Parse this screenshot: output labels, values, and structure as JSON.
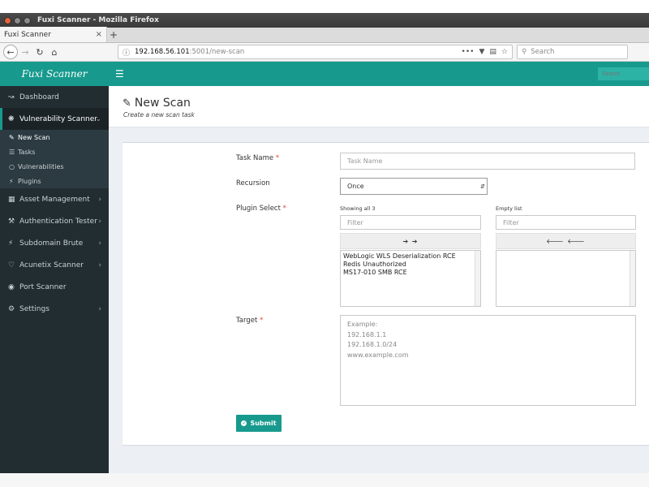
{
  "window": {
    "title": "Fuxi Scanner - Mozilla Firefox",
    "tab_title": "Fuxi Scanner",
    "tab_close": "×",
    "new_tab": "+"
  },
  "browser": {
    "url_host": "192.168.56.101",
    "url_path": ":5001/new-scan",
    "search_placeholder": "Search",
    "page_actions": "•••"
  },
  "app": {
    "brand": "Fuxi Scanner",
    "nav_search_placeholder": "Search",
    "accent_color": "#179a8d",
    "sidebar_color": "#222d32"
  },
  "sidebar": {
    "items": [
      {
        "label": "Dashboard",
        "icon": "line-chart-icon"
      },
      {
        "label": "Vulnerability Scanner",
        "icon": "bug-icon"
      },
      {
        "label": "Asset Management",
        "icon": "calendar-icon"
      },
      {
        "label": "Authentication Tester",
        "icon": "gavel-icon"
      },
      {
        "label": "Subdomain Brute",
        "icon": "bolt-icon"
      },
      {
        "label": "Acunetix Scanner",
        "icon": "heartbeat-icon"
      },
      {
        "label": "Port Scanner",
        "icon": "dot-circle-icon"
      },
      {
        "label": "Settings",
        "icon": "cogs-icon"
      }
    ],
    "sub_items": [
      {
        "label": "New Scan",
        "icon": "edit-icon"
      },
      {
        "label": "Tasks",
        "icon": "list-icon"
      },
      {
        "label": "Vulnerabilities",
        "icon": "circle-o-icon"
      },
      {
        "label": "Plugins",
        "icon": "plug-icon"
      }
    ]
  },
  "page": {
    "title": "New Scan",
    "subtitle": "Create a new scan task"
  },
  "form": {
    "task_name_label": "Task Name",
    "task_name_placeholder": "Task Name",
    "recursion_label": "Recursion",
    "recursion_value": "Once",
    "plugin_label": "Plugin Select",
    "required_mark": "*",
    "left_info": "Showing all 3",
    "right_info": "Empty list",
    "filter_placeholder": "Filter",
    "move_all_right": "➔ ➔",
    "move_all_left": "🡐 🡐",
    "plugins": [
      "WebLogic WLS Deserialization RCE",
      "Redis Unauthorized",
      "MS17-010 SMB RCE"
    ],
    "target_label": "Target",
    "target_placeholder": [
      "Example:",
      "192.168.1.1",
      "192.168.1.0/24",
      "www.example.com"
    ],
    "submit_label": "Submit"
  }
}
